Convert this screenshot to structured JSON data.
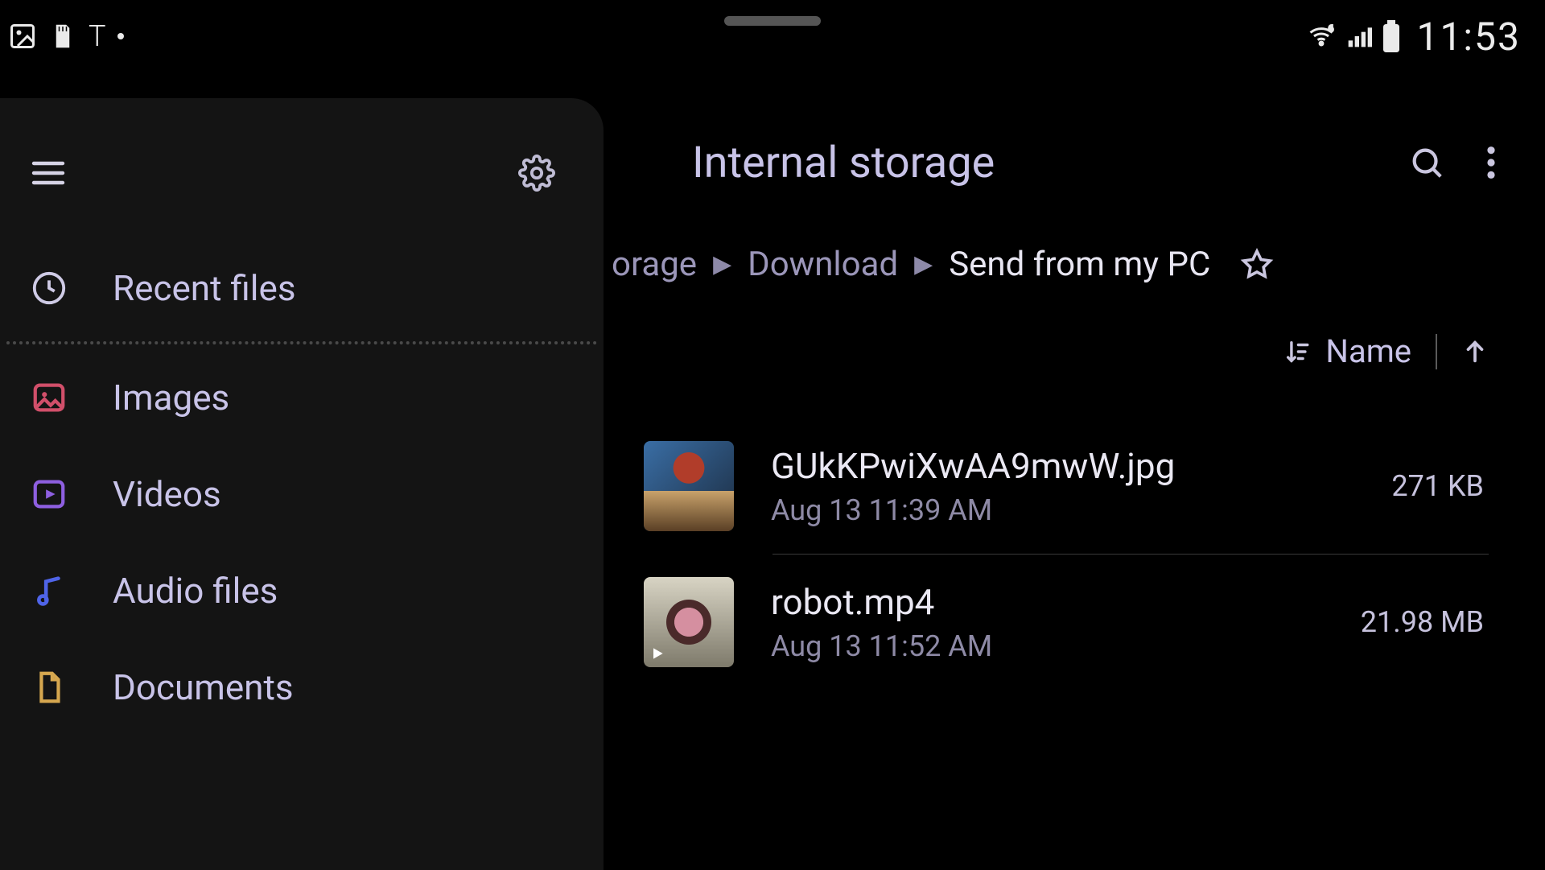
{
  "status_bar": {
    "clock": "11:53"
  },
  "sidebar": {
    "items": [
      {
        "id": "recent",
        "label": "Recent files",
        "icon": "clock-icon",
        "color": "#cfcbe6"
      },
      {
        "id": "images",
        "label": "Images",
        "icon": "image-icon",
        "color": "#d14f6a"
      },
      {
        "id": "videos",
        "label": "Videos",
        "icon": "video-icon",
        "color": "#8e5fe0"
      },
      {
        "id": "audio",
        "label": "Audio files",
        "icon": "music-icon",
        "color": "#4f64e8"
      },
      {
        "id": "documents",
        "label": "Documents",
        "icon": "document-icon",
        "color": "#d6a74f"
      }
    ]
  },
  "main": {
    "title": "Internal storage",
    "breadcrumb": {
      "clipped_prefix": "orage",
      "segments": [
        "Download",
        "Send from my PC"
      ],
      "active_index": 1
    },
    "sort": {
      "label": "Name",
      "direction": "asc"
    },
    "files": [
      {
        "name": "GUkKPwiXwAA9mwW.jpg",
        "modified": "Aug 13 11:39 AM",
        "size": "271 KB",
        "thumb": "character",
        "is_video": false
      },
      {
        "name": "robot.mp4",
        "modified": "Aug 13 11:52 AM",
        "size": "21.98 MB",
        "thumb": "video",
        "is_video": true
      }
    ]
  }
}
